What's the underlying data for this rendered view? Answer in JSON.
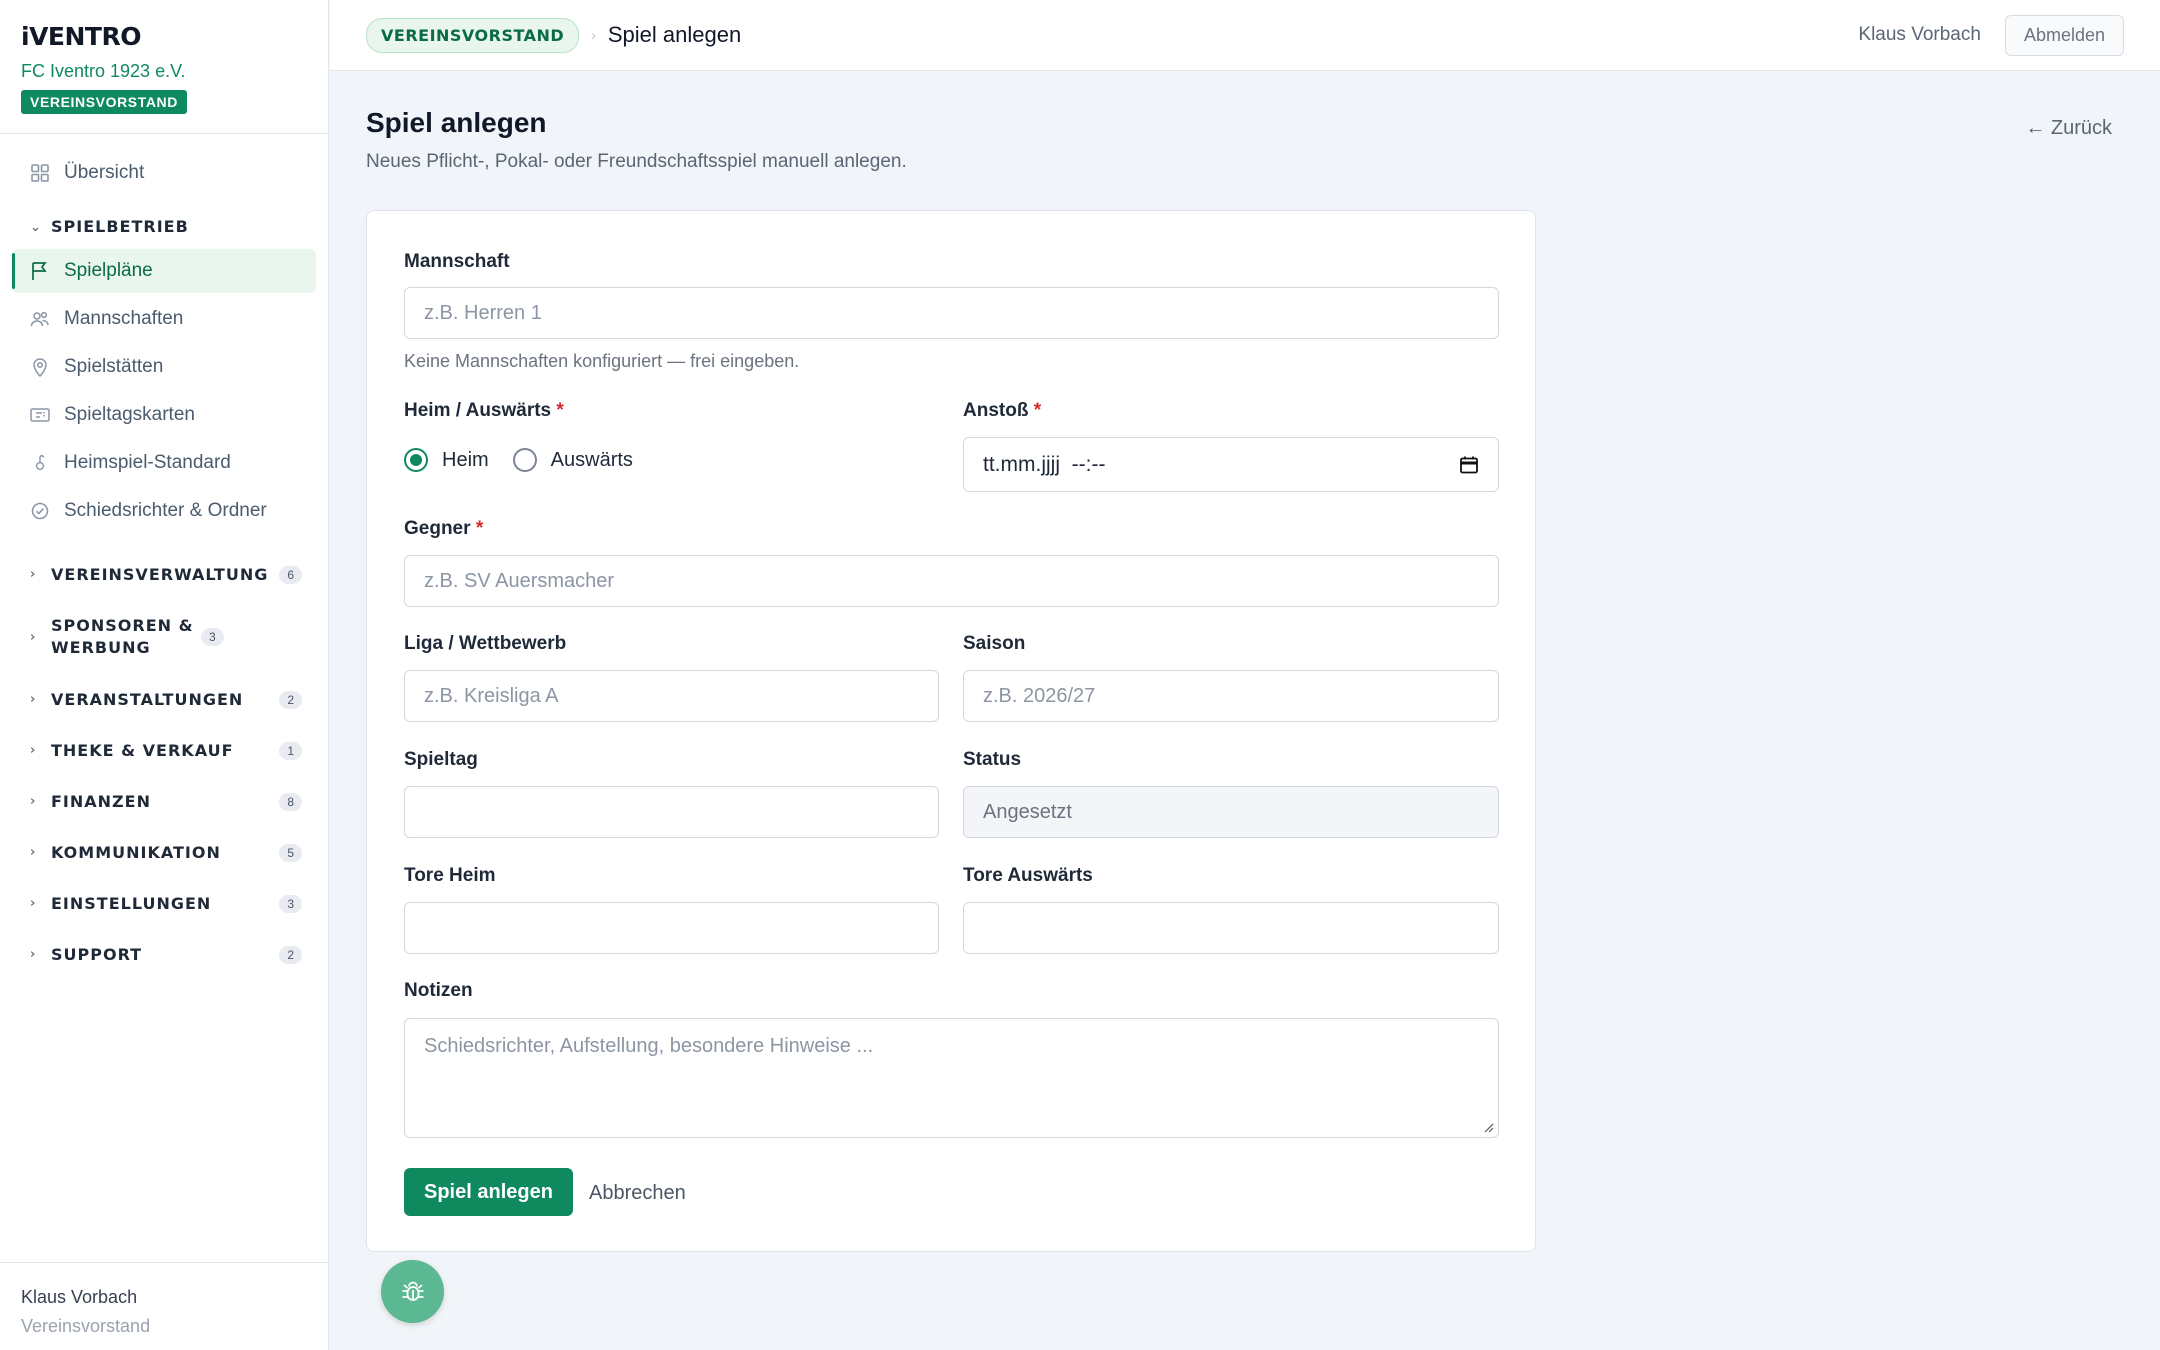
{
  "brand": {
    "logo": "iVENTRO",
    "club": "FC Iventro 1923 e.V.",
    "role_badge": "VEREINSVORSTAND"
  },
  "sidebar": {
    "overview": "Übersicht",
    "group_spielbetrieb": "SPIELBETRIEB",
    "items": [
      {
        "label": "Spielpläne",
        "icon": "flag-icon",
        "active": true
      },
      {
        "label": "Mannschaften",
        "icon": "team-icon"
      },
      {
        "label": "Spielstätten",
        "icon": "map-pin-icon"
      },
      {
        "label": "Spieltagskarten",
        "icon": "ticket-icon"
      },
      {
        "label": "Heimspiel-Standard",
        "icon": "link-icon"
      },
      {
        "label": "Schiedsrichter & Ordner",
        "icon": "check-circle-icon"
      }
    ],
    "groups": [
      {
        "label": "VEREINSVERWALTUNG",
        "count": "6"
      },
      {
        "label": "SPONSOREN & WERBUNG",
        "count": "3"
      },
      {
        "label": "VERANSTALTUNGEN",
        "count": "2"
      },
      {
        "label": "THEKE & VERKAUF",
        "count": "1"
      },
      {
        "label": "FINANZEN",
        "count": "8"
      },
      {
        "label": "KOMMUNIKATION",
        "count": "5"
      },
      {
        "label": "EINSTELLUNGEN",
        "count": "3"
      },
      {
        "label": "SUPPORT",
        "count": "2"
      }
    ],
    "footer": {
      "name": "Klaus Vorbach",
      "role": "Vereinsvorstand"
    }
  },
  "topbar": {
    "badge": "VEREINSVORSTAND",
    "title": "Spiel anlegen",
    "user": "Klaus Vorbach",
    "logout": "Abmelden"
  },
  "page": {
    "title": "Spiel anlegen",
    "subtitle": "Neues Pflicht-, Pokal- oder Freundschaftsspiel manuell anlegen.",
    "back": "← Zurück"
  },
  "form": {
    "mannschaft": {
      "label": "Mannschaft",
      "placeholder": "z.B. Herren 1",
      "help": "Keine Mannschaften konfiguriert — frei eingeben."
    },
    "heim_auswaerts": {
      "label": "Heim / Auswärts",
      "required": "*",
      "option_heim": "Heim",
      "option_auswaerts": "Auswärts",
      "selected": "Heim"
    },
    "anstoss": {
      "label": "Anstoß",
      "required": "*",
      "value": "tt.mm.jjjj  --:--"
    },
    "gegner": {
      "label": "Gegner",
      "required": "*",
      "placeholder": "z.B. SV Auersmacher"
    },
    "liga": {
      "label": "Liga / Wettbewerb",
      "placeholder": "z.B. Kreisliga A"
    },
    "saison": {
      "label": "Saison",
      "placeholder": "z.B. 2026/27"
    },
    "spieltag": {
      "label": "Spieltag",
      "value": ""
    },
    "status": {
      "label": "Status",
      "value": "Angesetzt"
    },
    "tore_heim": {
      "label": "Tore Heim",
      "value": ""
    },
    "tore_auswaerts": {
      "label": "Tore Auswärts",
      "value": ""
    },
    "notizen": {
      "label": "Notizen",
      "placeholder": "Schiedsrichter, Aufstellung, besondere Hinweise ..."
    },
    "submit": "Spiel anlegen",
    "cancel": "Abbrechen"
  },
  "colors": {
    "accent": "#0f8a5f",
    "required": "#d12a2a",
    "bg": "#f1f4f8"
  }
}
